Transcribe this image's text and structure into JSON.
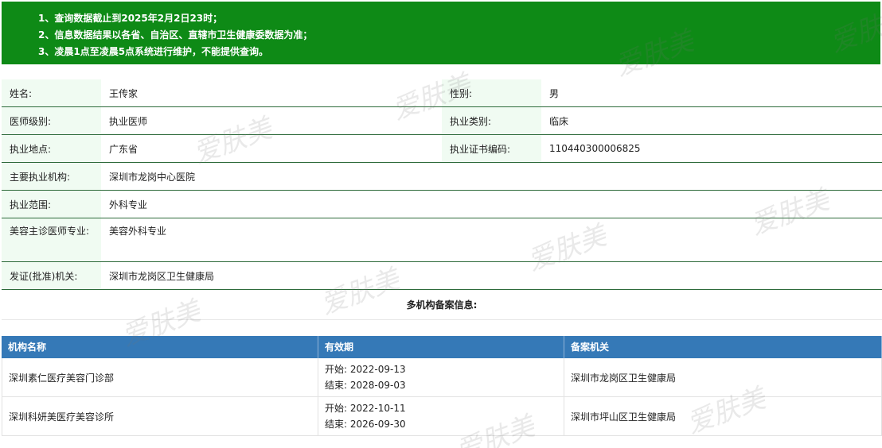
{
  "notice": {
    "lines": [
      "1、查询数据截止到2025年2月2日23时；",
      "2、信息数据结果以各省、自治区、直辖市卫生健康委数据为准；",
      "3、凌晨1点至凌晨5点系统进行维护，不能提供查询。"
    ],
    "background_color": "#0e8a16"
  },
  "info": {
    "name_label": "姓名:",
    "name": "王传家",
    "gender_label": "性别:",
    "gender": "男",
    "level_label": "医师级别:",
    "level": "执业医师",
    "category_label": "执业类别:",
    "category": "临床",
    "location_label": "执业地点:",
    "location": "广东省",
    "cert_label": "执业证书编码:",
    "cert_no": "110440300006825",
    "institution_label": "主要执业机构:",
    "institution": "深圳市龙岗中心医院",
    "scope_label": "执业范围:",
    "scope": "外科专业",
    "cosmetic_label": "美容主诊医师专业:",
    "cosmetic": "美容外科专业",
    "issuer_label": "发证(批准)机关:",
    "issuer": "深圳市龙岗区卫生健康局"
  },
  "multi_title": "多机构备案信息:",
  "records": {
    "header_color": "#3579b7",
    "headers": [
      "机构名称",
      "有效期",
      "备案机关"
    ],
    "start_prefix": "开始:",
    "end_prefix": "结束:",
    "rows": [
      {
        "org": "深圳素仁医疗美容门诊部",
        "start": "2022-09-13",
        "end": "2028-09-03",
        "authority": "深圳市龙岗区卫生健康局"
      },
      {
        "org": "深圳科妍美医疗美容诊所",
        "start": "2022-10-11",
        "end": "2026-09-30",
        "authority": "深圳市坪山区卫生健康局"
      }
    ]
  },
  "watermark": {
    "text": "爱肤美"
  }
}
